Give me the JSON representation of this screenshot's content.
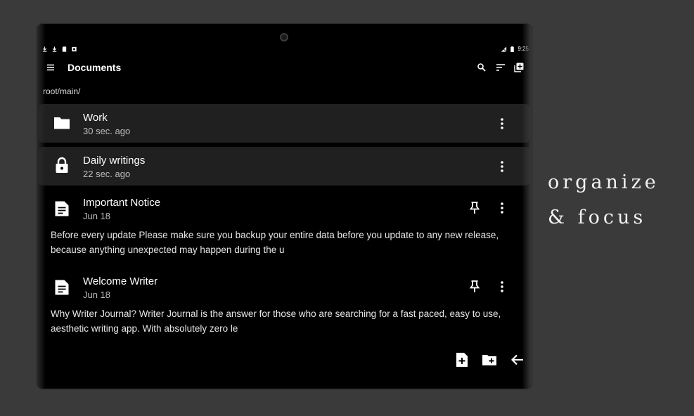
{
  "status_bar": {
    "left_icons": [
      "download-icon",
      "download-icon",
      "sd-card-icon",
      "media-icon"
    ],
    "right_icons": [
      "no-signal-icon",
      "battery-icon"
    ],
    "time": "9:25"
  },
  "app_bar": {
    "title": "Documents",
    "actions": [
      "search-icon",
      "sort-icon",
      "library-add-icon"
    ]
  },
  "breadcrumb": "root/main/",
  "items": [
    {
      "kind": "folder",
      "icon": "folder-icon",
      "title": "Work",
      "subtitle": "30 sec. ago"
    },
    {
      "kind": "folder",
      "icon": "lock-icon",
      "title": "Daily writings",
      "subtitle": "22 sec. ago"
    },
    {
      "kind": "note",
      "icon": "document-icon",
      "title": "Important Notice",
      "subtitle": "Jun 18",
      "pinned": true,
      "preview": "Before every update Please make sure you backup your entire data before you update to any new release, because anything unexpected may happen during the u"
    },
    {
      "kind": "note",
      "icon": "document-icon",
      "title": "Welcome Writer",
      "subtitle": "Jun 18",
      "pinned": true,
      "preview": "Why Writer Journal? Writer Journal is the answer for those who are searching for a fast paced, easy to use, aesthetic writing app. With absolutely zero le"
    }
  ],
  "bottom_actions": [
    "new-note-icon",
    "new-folder-icon",
    "back-arrow-icon"
  ],
  "tagline": {
    "line1": "organize",
    "line2": "& focus"
  },
  "colors": {
    "background": "#3a3a3a",
    "screen": "#000000",
    "card": "#202020",
    "text": "#ffffff",
    "subtext": "#bdbdbd"
  }
}
